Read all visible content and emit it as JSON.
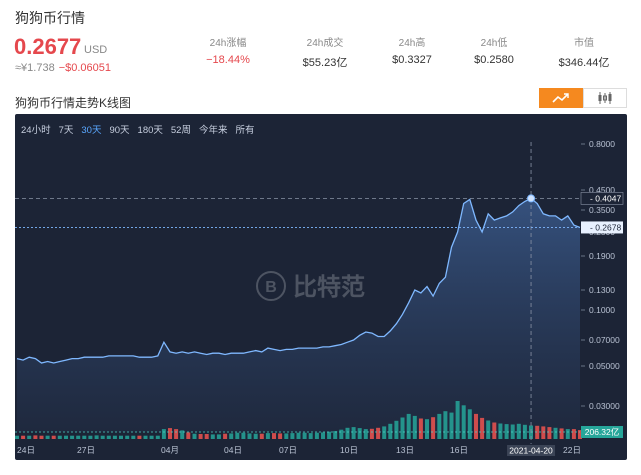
{
  "header": {
    "title": "狗狗币行情",
    "price": "0.2677",
    "currency": "USD",
    "cny": "≈¥1.738",
    "change": "−$0.06051"
  },
  "stats": [
    {
      "label": "24h涨幅",
      "value": "−18.44%",
      "negative": true
    },
    {
      "label": "24h成交",
      "value": "$55.23亿",
      "negative": false
    },
    {
      "label": "24h高",
      "value": "$0.3327",
      "negative": false
    },
    {
      "label": "24h低",
      "value": "$0.2580",
      "negative": false
    },
    {
      "label": "市值",
      "value": "$346.44亿",
      "negative": false
    }
  ],
  "section_title": "狗狗币行情走势K线图",
  "view_toggle": {
    "active": "line-chart-icon",
    "inactive": "candlestick-icon"
  },
  "ranges": [
    "24小时",
    "7天",
    "30天",
    "90天",
    "180天",
    "52周",
    "今年来",
    "所有"
  ],
  "active_range": "30天",
  "watermark": "比特范",
  "colors": {
    "up": "#26a69a",
    "down": "#ef5350",
    "line": "#7fb8ff",
    "accent": "#f5891f",
    "price_red": "#e5484d"
  },
  "chart_data": {
    "type": "line",
    "scale": "log",
    "y_ticks": [
      "0.8000",
      "0.4500",
      "0.3500",
      "0.2500",
      "0.1900",
      "0.1300",
      "0.1000",
      "0.07000",
      "0.05000",
      "0.03000"
    ],
    "x_ticks": [
      "24日",
      "27日",
      "04月",
      "04日",
      "07日",
      "10日",
      "13日",
      "16日",
      "19日",
      "22日"
    ],
    "crosshair": {
      "x_label": "2021-04-20",
      "y_label": "0.4047"
    },
    "last_price_label": "0.2678",
    "volume_label": "206.32亿",
    "prices": [
      0.055,
      0.054,
      0.056,
      0.055,
      0.052,
      0.053,
      0.052,
      0.053,
      0.054,
      0.055,
      0.055,
      0.056,
      0.056,
      0.056,
      0.056,
      0.057,
      0.057,
      0.057,
      0.057,
      0.057,
      0.056,
      0.056,
      0.056,
      0.057,
      0.068,
      0.06,
      0.059,
      0.06,
      0.059,
      0.06,
      0.059,
      0.058,
      0.059,
      0.059,
      0.058,
      0.059,
      0.059,
      0.059,
      0.06,
      0.061,
      0.06,
      0.063,
      0.062,
      0.061,
      0.062,
      0.062,
      0.063,
      0.063,
      0.063,
      0.063,
      0.064,
      0.064,
      0.065,
      0.066,
      0.068,
      0.07,
      0.074,
      0.077,
      0.076,
      0.073,
      0.073,
      0.078,
      0.085,
      0.095,
      0.11,
      0.13,
      0.125,
      0.135,
      0.12,
      0.14,
      0.15,
      0.21,
      0.25,
      0.38,
      0.4,
      0.3,
      0.25,
      0.33,
      0.3,
      0.31,
      0.32,
      0.34,
      0.37,
      0.39,
      0.405,
      0.38,
      0.33,
      0.32,
      0.32,
      0.3,
      0.32,
      0.278,
      0.268
    ],
    "volumes": [
      1.0,
      1.0,
      1.0,
      1.1,
      1.0,
      1.0,
      1.0,
      1.0,
      1.0,
      1.0,
      1.0,
      1.0,
      1.0,
      1.1,
      1.0,
      1.0,
      1.0,
      1.0,
      1.0,
      1.0,
      1.0,
      1.0,
      1.0,
      1.0,
      3.0,
      3.3,
      3.0,
      2.6,
      2.0,
      1.6,
      1.5,
      1.5,
      1.4,
      1.4,
      1.6,
      1.7,
      1.9,
      1.9,
      1.7,
      1.6,
      1.6,
      1.8,
      1.8,
      1.7,
      1.7,
      1.8,
      1.9,
      1.9,
      1.8,
      1.9,
      2.0,
      2.2,
      2.4,
      2.8,
      3.4,
      3.6,
      3.3,
      3.0,
      3.1,
      3.4,
      3.8,
      4.6,
      5.5,
      6.5,
      7.6,
      7.0,
      6.2,
      6.0,
      6.6,
      7.6,
      8.4,
      8.0,
      11.5,
      10.2,
      9.0,
      7.6,
      6.4,
      5.6,
      5.0,
      4.7,
      4.5,
      4.4,
      4.6,
      4.3,
      4.1,
      4.0,
      3.8,
      3.6,
      3.4,
      3.2,
      3.0,
      3.0,
      2.7
    ]
  }
}
